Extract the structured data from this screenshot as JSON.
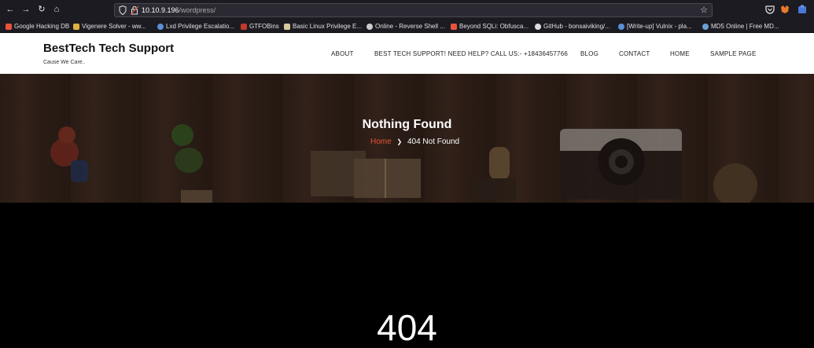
{
  "browser": {
    "url_host": "10.10.9.196",
    "url_path": "/wordpress/",
    "bookmarks": [
      {
        "label": "Google Hacking DB",
        "color": "#e8533a"
      },
      {
        "label": "Vigenere Solver - ww...",
        "color": "#e0b040"
      },
      {
        "label": "Lxd Privilege Escalatio...",
        "color": "#5a8fd8"
      },
      {
        "label": "GTFOBins",
        "color": "#c0392b"
      },
      {
        "label": "Basic Linux Privilege E...",
        "color": "#d8c9a0"
      },
      {
        "label": "Online - Reverse Shell ...",
        "color": "#cccccc"
      },
      {
        "label": "Beyond SQLi: Obfusca...",
        "color": "#e8533a"
      },
      {
        "label": "GitHub - bonsaiviking/...",
        "color": "#dddddd"
      },
      {
        "label": "[Write-up] Vulnix - pla...",
        "color": "#5a8fd8"
      },
      {
        "label": "MD5 Online | Free MD...",
        "color": "#6aa0d8"
      }
    ]
  },
  "site": {
    "brand": "BestTech Tech Support",
    "tagline": "Cause We Care..",
    "menu": [
      "ABOUT",
      "BEST TECH SUPPORT! NEED HELP? CALL US:- +18436457766",
      "BLOG",
      "CONTACT",
      "HOME",
      "SAMPLE PAGE"
    ]
  },
  "hero": {
    "title": "Nothing Found",
    "breadcrumb_home": "Home",
    "breadcrumb_sep": "❯",
    "breadcrumb_current": "404 Not Found"
  },
  "main": {
    "code": "404"
  },
  "colors": {
    "accent": "#e8533a",
    "chrome_bg": "#1c1b22"
  }
}
